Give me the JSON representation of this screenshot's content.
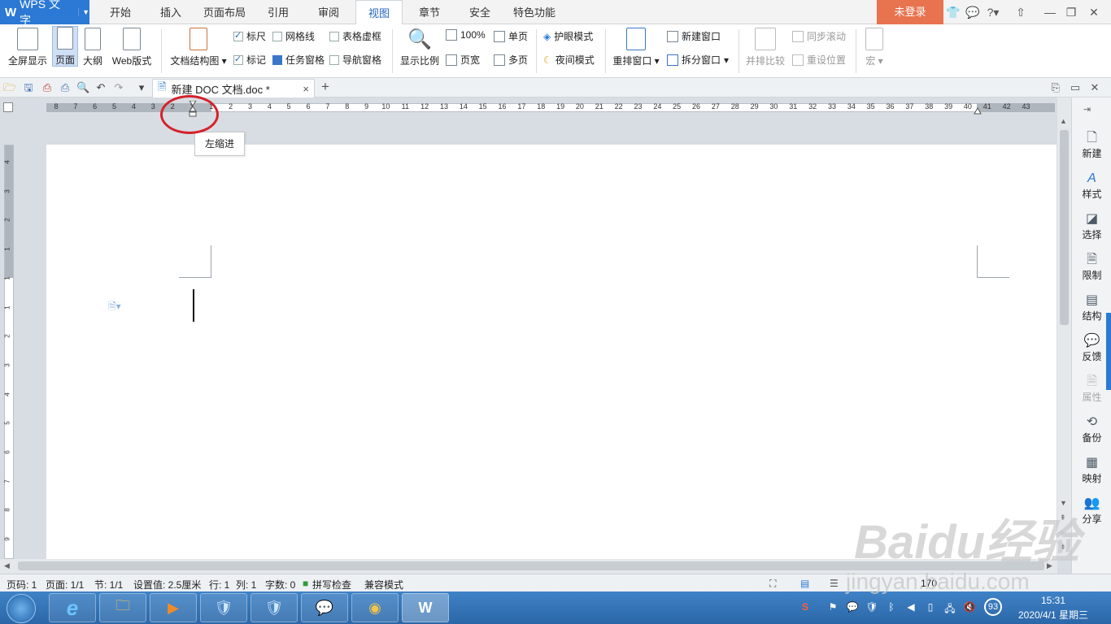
{
  "app": {
    "logo": "W",
    "name": "WPS 文字",
    "dropdown": "▼"
  },
  "menu_tabs": [
    "开始",
    "插入",
    "页面布局",
    "引用",
    "审阅",
    "视图",
    "章节",
    "安全",
    "特色功能"
  ],
  "active_tab": "视图",
  "login_label": "未登录",
  "ribbon": {
    "fullscreen": "全屏显示",
    "page": "页面",
    "outline": "大纲",
    "web": "Web版式",
    "doc_structure": "文档结构图",
    "ruler": "标尺",
    "gridlines": "网格线",
    "table_dotted": "表格虚框",
    "marks": "标记",
    "task_pane": "任务窗格",
    "nav_pane": "导航窗格",
    "zoom_ratio": "显示比例",
    "zoom_100": "100%",
    "page_width": "页宽",
    "single_page": "单页",
    "multi_page": "多页",
    "eye_mode": "护眼模式",
    "night_mode": "夜间模式",
    "arrange": "重排窗口",
    "new_window": "新建窗口",
    "split_window": "拆分窗口",
    "side_by_side": "并排比较",
    "sync_scroll": "同步滚动",
    "reset_position": "重设位置",
    "macro": "宏"
  },
  "doc_tab": {
    "title": "新建 DOC 文档.doc *",
    "close": "×",
    "add": "+"
  },
  "ruler_numbers": [
    "8",
    "7",
    "6",
    "5",
    "4",
    "3",
    "2",
    "1",
    "1",
    "2",
    "3",
    "4",
    "5",
    "6",
    "7",
    "8",
    "9",
    "10",
    "11",
    "12",
    "13",
    "14",
    "15",
    "16",
    "17",
    "18",
    "19",
    "20",
    "21",
    "22",
    "23",
    "24",
    "25",
    "26",
    "27",
    "28",
    "29",
    "30",
    "31",
    "32",
    "33",
    "34",
    "35",
    "36",
    "37",
    "38",
    "39",
    "40",
    "41",
    "42",
    "43"
  ],
  "vruler_numbers": [
    "4",
    "3",
    "2",
    "1",
    "1",
    "1",
    "2",
    "3",
    "4",
    "5",
    "6",
    "7",
    "8",
    "9"
  ],
  "tooltip": "左缩进",
  "right_panel": [
    {
      "label": "新建",
      "icon": "new-doc-icon",
      "glyph": "🗋"
    },
    {
      "label": "样式",
      "icon": "style-icon",
      "glyph": "A"
    },
    {
      "label": "选择",
      "icon": "select-icon",
      "glyph": "◪"
    },
    {
      "label": "限制",
      "icon": "restrict-icon",
      "glyph": "🗎"
    },
    {
      "label": "结构",
      "icon": "structure-icon",
      "glyph": "▤"
    },
    {
      "label": "反馈",
      "icon": "feedback-icon",
      "glyph": "💬"
    },
    {
      "label": "属性",
      "icon": "property-icon",
      "glyph": "🗎"
    },
    {
      "label": "备份",
      "icon": "backup-icon",
      "glyph": "⟲"
    },
    {
      "label": "映射",
      "icon": "mapping-icon",
      "glyph": "▦"
    },
    {
      "label": "分享",
      "icon": "share-icon",
      "glyph": "👥"
    }
  ],
  "status": {
    "page_num": "页码: 1",
    "pages": "页面: 1/1",
    "section": "节: 1/1",
    "setting": "设置值: 2.5厘米",
    "row": "行: 1",
    "col": "列: 1",
    "words": "字数: 0",
    "spell": "拼写检查",
    "compat": "兼容模式",
    "zoom": "170"
  },
  "clock": {
    "time": "15:31",
    "date": "2020/4/1 星期三"
  },
  "tray_badge": "93",
  "watermark": "Baidu经验",
  "watermark_url": "jingyan.baidu.com"
}
